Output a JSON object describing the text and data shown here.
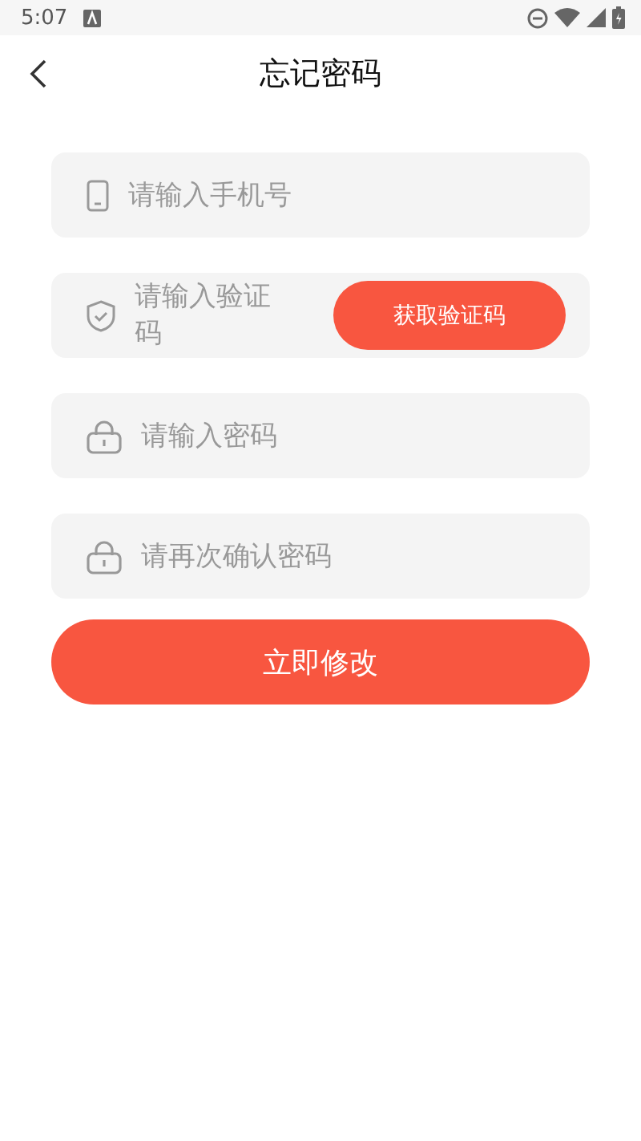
{
  "status_bar": {
    "time": "5:07"
  },
  "header": {
    "title": "忘记密码"
  },
  "fields": [
    {
      "kind": "phone",
      "placeholder": "请输入手机号"
    },
    {
      "kind": "code",
      "placeholder": "请输入验证码",
      "button": "获取验证码"
    },
    {
      "kind": "password",
      "placeholder": "请输入密码"
    },
    {
      "kind": "password",
      "placeholder": "请再次确认密码"
    }
  ],
  "submit_button": "立即修改"
}
